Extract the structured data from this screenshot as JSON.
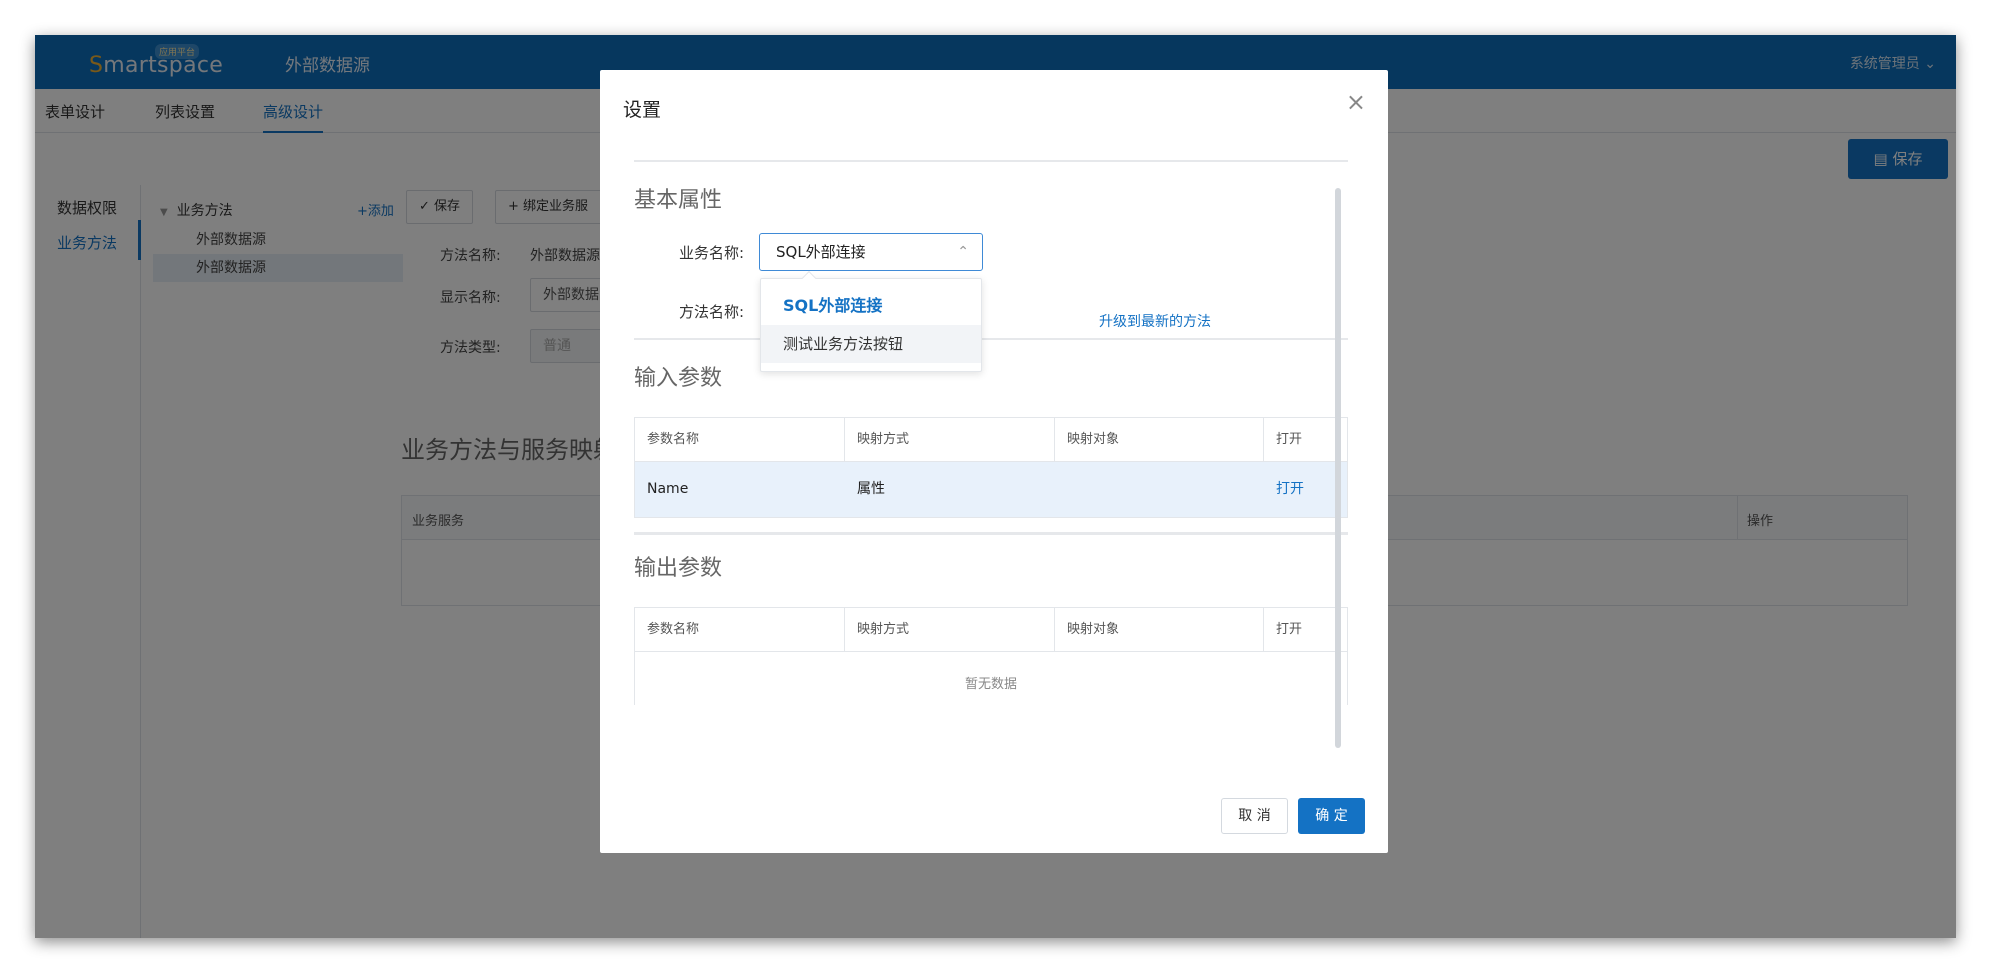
{
  "header": {
    "logo_text_s": "S",
    "logo_text_rest": "martspace",
    "logo_badge": "应用平台",
    "app_title": "外部数据源",
    "user_menu": "系统管理员"
  },
  "tabs": [
    "表单设计",
    "列表设置",
    "高级设计"
  ],
  "toolbar": {
    "save_label": "保存"
  },
  "left_nav": {
    "items": [
      "数据权限",
      "业务方法"
    ]
  },
  "tree": {
    "root_label": "业务方法",
    "add_label": "+添加",
    "nodes": [
      "外部数据源",
      "外部数据源"
    ]
  },
  "method_toolbar": {
    "save_label": "保存",
    "bind_label": "绑定业务服"
  },
  "method_form": {
    "method_name_label": "方法名称:",
    "method_name_value": "外部数据源",
    "display_name_label": "显示名称:",
    "display_name_value": "外部数据",
    "method_type_label": "方法类型:",
    "method_type_value": "普通"
  },
  "mapping": {
    "title": "业务方法与服务映射",
    "columns": [
      "业务服务",
      "操作"
    ]
  },
  "modal": {
    "title": "设置",
    "basic_section": "基本属性",
    "business_name_label": "业务名称:",
    "business_name_value": "SQL外部连接",
    "method_name_label": "方法名称:",
    "upgrade_link": "升级到最新的方法",
    "dropdown_options": [
      "SQL外部连接",
      "测试业务方法按钮"
    ],
    "input_section": "输入参数",
    "output_section": "输出参数",
    "param_columns": [
      "参数名称",
      "映射方式",
      "映射对象",
      "打开"
    ],
    "input_rows": [
      {
        "name": "Name",
        "mode": "属性",
        "target": "",
        "action": "打开"
      }
    ],
    "empty_text": "暂无数据",
    "cancel_label": "取 消",
    "ok_label": "确 定"
  }
}
